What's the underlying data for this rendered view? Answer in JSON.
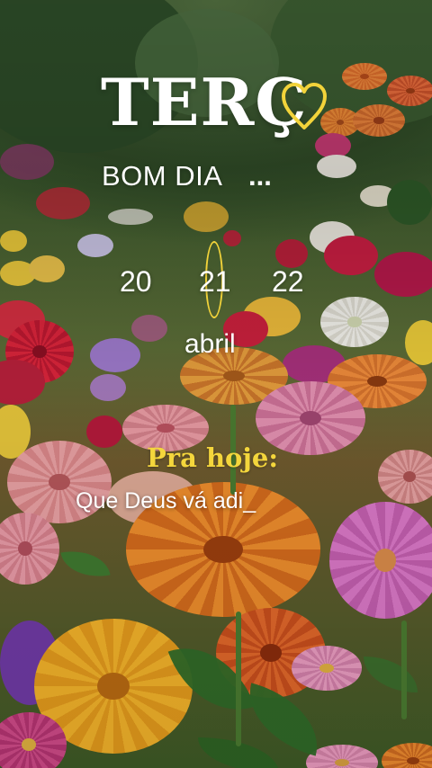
{
  "header": {
    "day": "TERÇ",
    "heart_icon": "heart-outline-icon",
    "greeting": "BOM DIA",
    "ellipsis": "..."
  },
  "dates": {
    "previous": "20",
    "current": "21",
    "next": "22",
    "month": "abril"
  },
  "today": {
    "heading": "Pra hoje:",
    "message": "Que Deus vá adi_"
  },
  "colors": {
    "accent_yellow": "#f2d33a",
    "text_white": "#ffffff"
  }
}
